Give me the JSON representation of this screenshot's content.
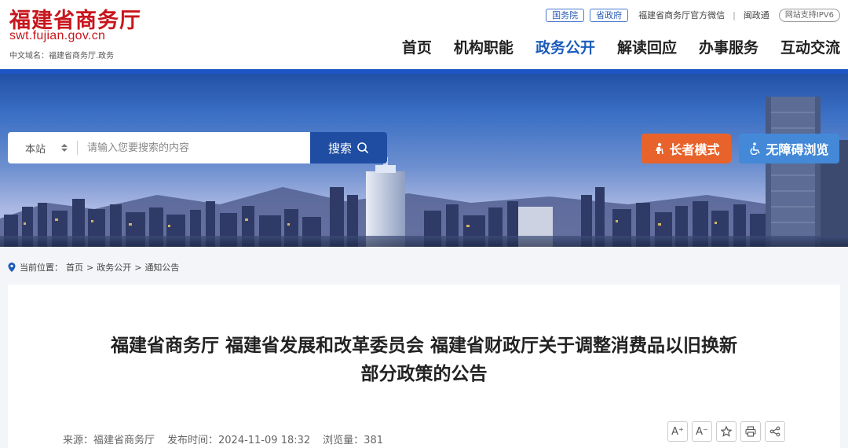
{
  "header": {
    "logo_cn": "福建省商务厅",
    "logo_url": "swt.fujian.gov.cn",
    "domain_label": "中文域名：福建省商务厅.政务",
    "top_links": {
      "pill_1": "国务院",
      "pill_2": "省政府",
      "wechat": "福建省商务厅官方微信",
      "separator": "|",
      "minzhengtong": "闽政通",
      "ipv6": "网站支持IPV6"
    },
    "nav": [
      "首页",
      "机构职能",
      "政务公开",
      "解读回应",
      "办事服务",
      "互动交流"
    ],
    "nav_active_index": 2
  },
  "banner": {
    "search": {
      "scope": "本站",
      "placeholder": "请输入您要搜索的内容",
      "button": "搜索"
    },
    "elder_mode": "长者模式",
    "accessible": "无障碍浏览"
  },
  "breadcrumb": {
    "label": "当前位置：",
    "items": [
      "首页",
      "政务公开",
      "通知公告"
    ],
    "separator": ">"
  },
  "article": {
    "title_line1": "福建省商务厅 福建省发展和改革委员会 福建省财政厅关于调整消费品以旧换新",
    "title_line2": "部分政策的公告",
    "source": "来源：福建省商务厅",
    "published": "发布时间：2024-11-09 18:32",
    "views": "浏览量：381",
    "tools": [
      "A⁺",
      "A⁻"
    ]
  },
  "colors": {
    "brand_red": "#c8161d",
    "nav_active": "#1d5cbb",
    "search_button": "#1f4da2",
    "elder_button": "#e8632b",
    "access_button": "#4389d8"
  }
}
